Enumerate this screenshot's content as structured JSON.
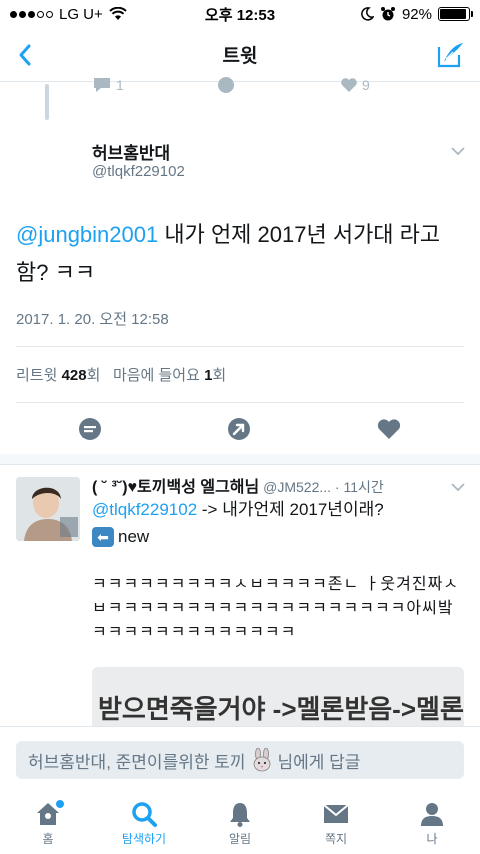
{
  "status_bar": {
    "carrier": "LG U+",
    "time": "오후 12:53",
    "battery_percent": "92%",
    "battery_level": 0.92
  },
  "nav": {
    "title": "트윗"
  },
  "prev_tweet": {
    "reply_count": "1",
    "like_count": "9"
  },
  "tweet": {
    "author_name": "허브홈반대",
    "author_handle": "@tlqkf229102",
    "mention": "@jungbin2001",
    "text": " 내가 언제 2017년 서가대 라고함? ㅋㅋ",
    "date": "2017. 1. 20. 오전 12:58",
    "stats": {
      "retweet_label": "리트윗",
      "retweet_count": "428",
      "retweet_unit": "회",
      "like_label": "마음에 들어요",
      "like_count": "1",
      "like_unit": "회"
    }
  },
  "reply": {
    "name": "( ˘ ³˘)♥토끼백성 엘그해님",
    "handle_time": " @JM522... · 11시간",
    "mention": "@tlqkf229102",
    "text": "  -> 내가언제 2017년이래?",
    "new_text": "new",
    "body": "ㅋㅋㅋㅋㅋㅋㅋㅋㅋㅅㅂㅋㅋㅋㅋ존ㄴ ㅏ웃겨진짜ㅅㅂㅋㅋㅋㅋㅋㅋㅋㅋㅋㅋㅋㅋㅋㅋㅋㅋㅋㅋㅋ아씨밬ㅋㅋㅋㅋㅋㅋㅋㅋㅋㅋㅋㅋㅋ",
    "image_text": "받으면죽을거야 ->멜론받음->멜론"
  },
  "reply_bar": {
    "placeholder_prefix": "허브홈반대, 준면이를위한 토끼",
    "placeholder_suffix": " 님에게 답글"
  },
  "tabs": [
    {
      "label": "홈",
      "icon": "home-icon"
    },
    {
      "label": "탐색하기",
      "icon": "search-icon"
    },
    {
      "label": "알림",
      "icon": "bell-icon"
    },
    {
      "label": "쪽지",
      "icon": "mail-icon"
    },
    {
      "label": "나",
      "icon": "person-icon"
    }
  ],
  "colors": {
    "accent": "#1da1f2",
    "muted": "#657786",
    "icon_gray": "#8899a6"
  }
}
